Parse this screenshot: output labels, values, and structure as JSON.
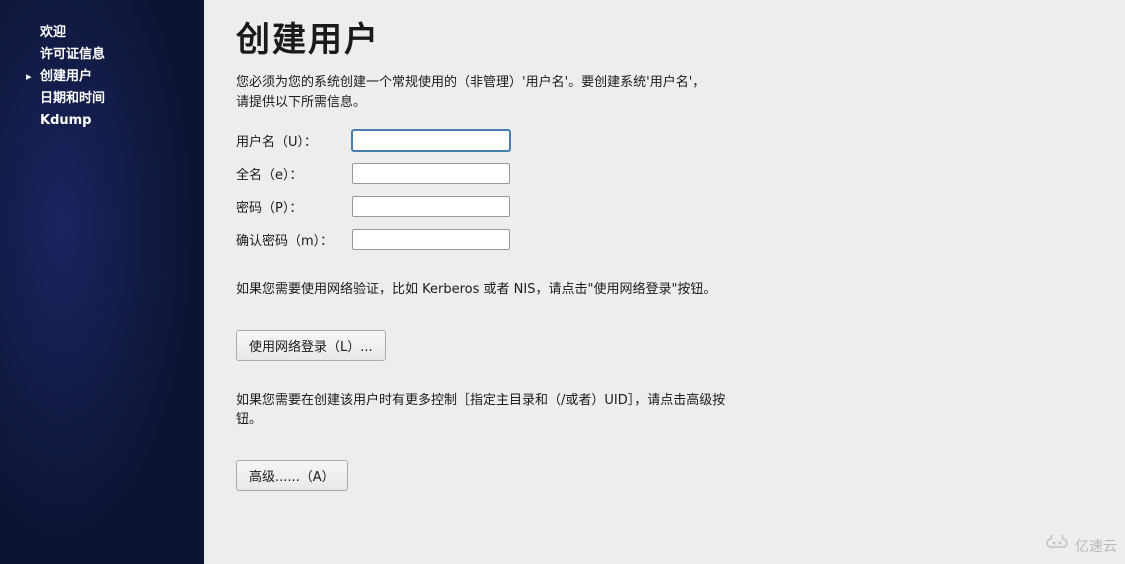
{
  "sidebar": {
    "items": [
      {
        "label": "欢迎",
        "active": false
      },
      {
        "label": "许可证信息",
        "active": false
      },
      {
        "label": "创建用户",
        "active": true
      },
      {
        "label": "日期和时间",
        "active": false
      },
      {
        "label": "Kdump",
        "active": false
      }
    ]
  },
  "main": {
    "title": "创建用户",
    "description": "您必须为您的系统创建一个常规使用的（非管理）'用户名'。要创建系统'用户名'，请提供以下所需信息。",
    "form": {
      "username_label": "用户名（U）：",
      "username_value": "",
      "fullname_label": "全名（e）：",
      "fullname_value": "",
      "password_label": "密码（P）：",
      "password_value": "",
      "confirm_label": "确认密码（m）：",
      "confirm_value": ""
    },
    "network_info": "如果您需要使用网络验证，比如 Kerberos 或者 NIS，请点击\"使用网络登录\"按钮。",
    "network_button": "使用网络登录（L）...",
    "advanced_info": "如果您需要在创建该用户时有更多控制［指定主目录和（/或者）UID］，请点击高级按钮。",
    "advanced_button": "高级......（A）"
  },
  "watermark": {
    "text": "亿速云"
  }
}
